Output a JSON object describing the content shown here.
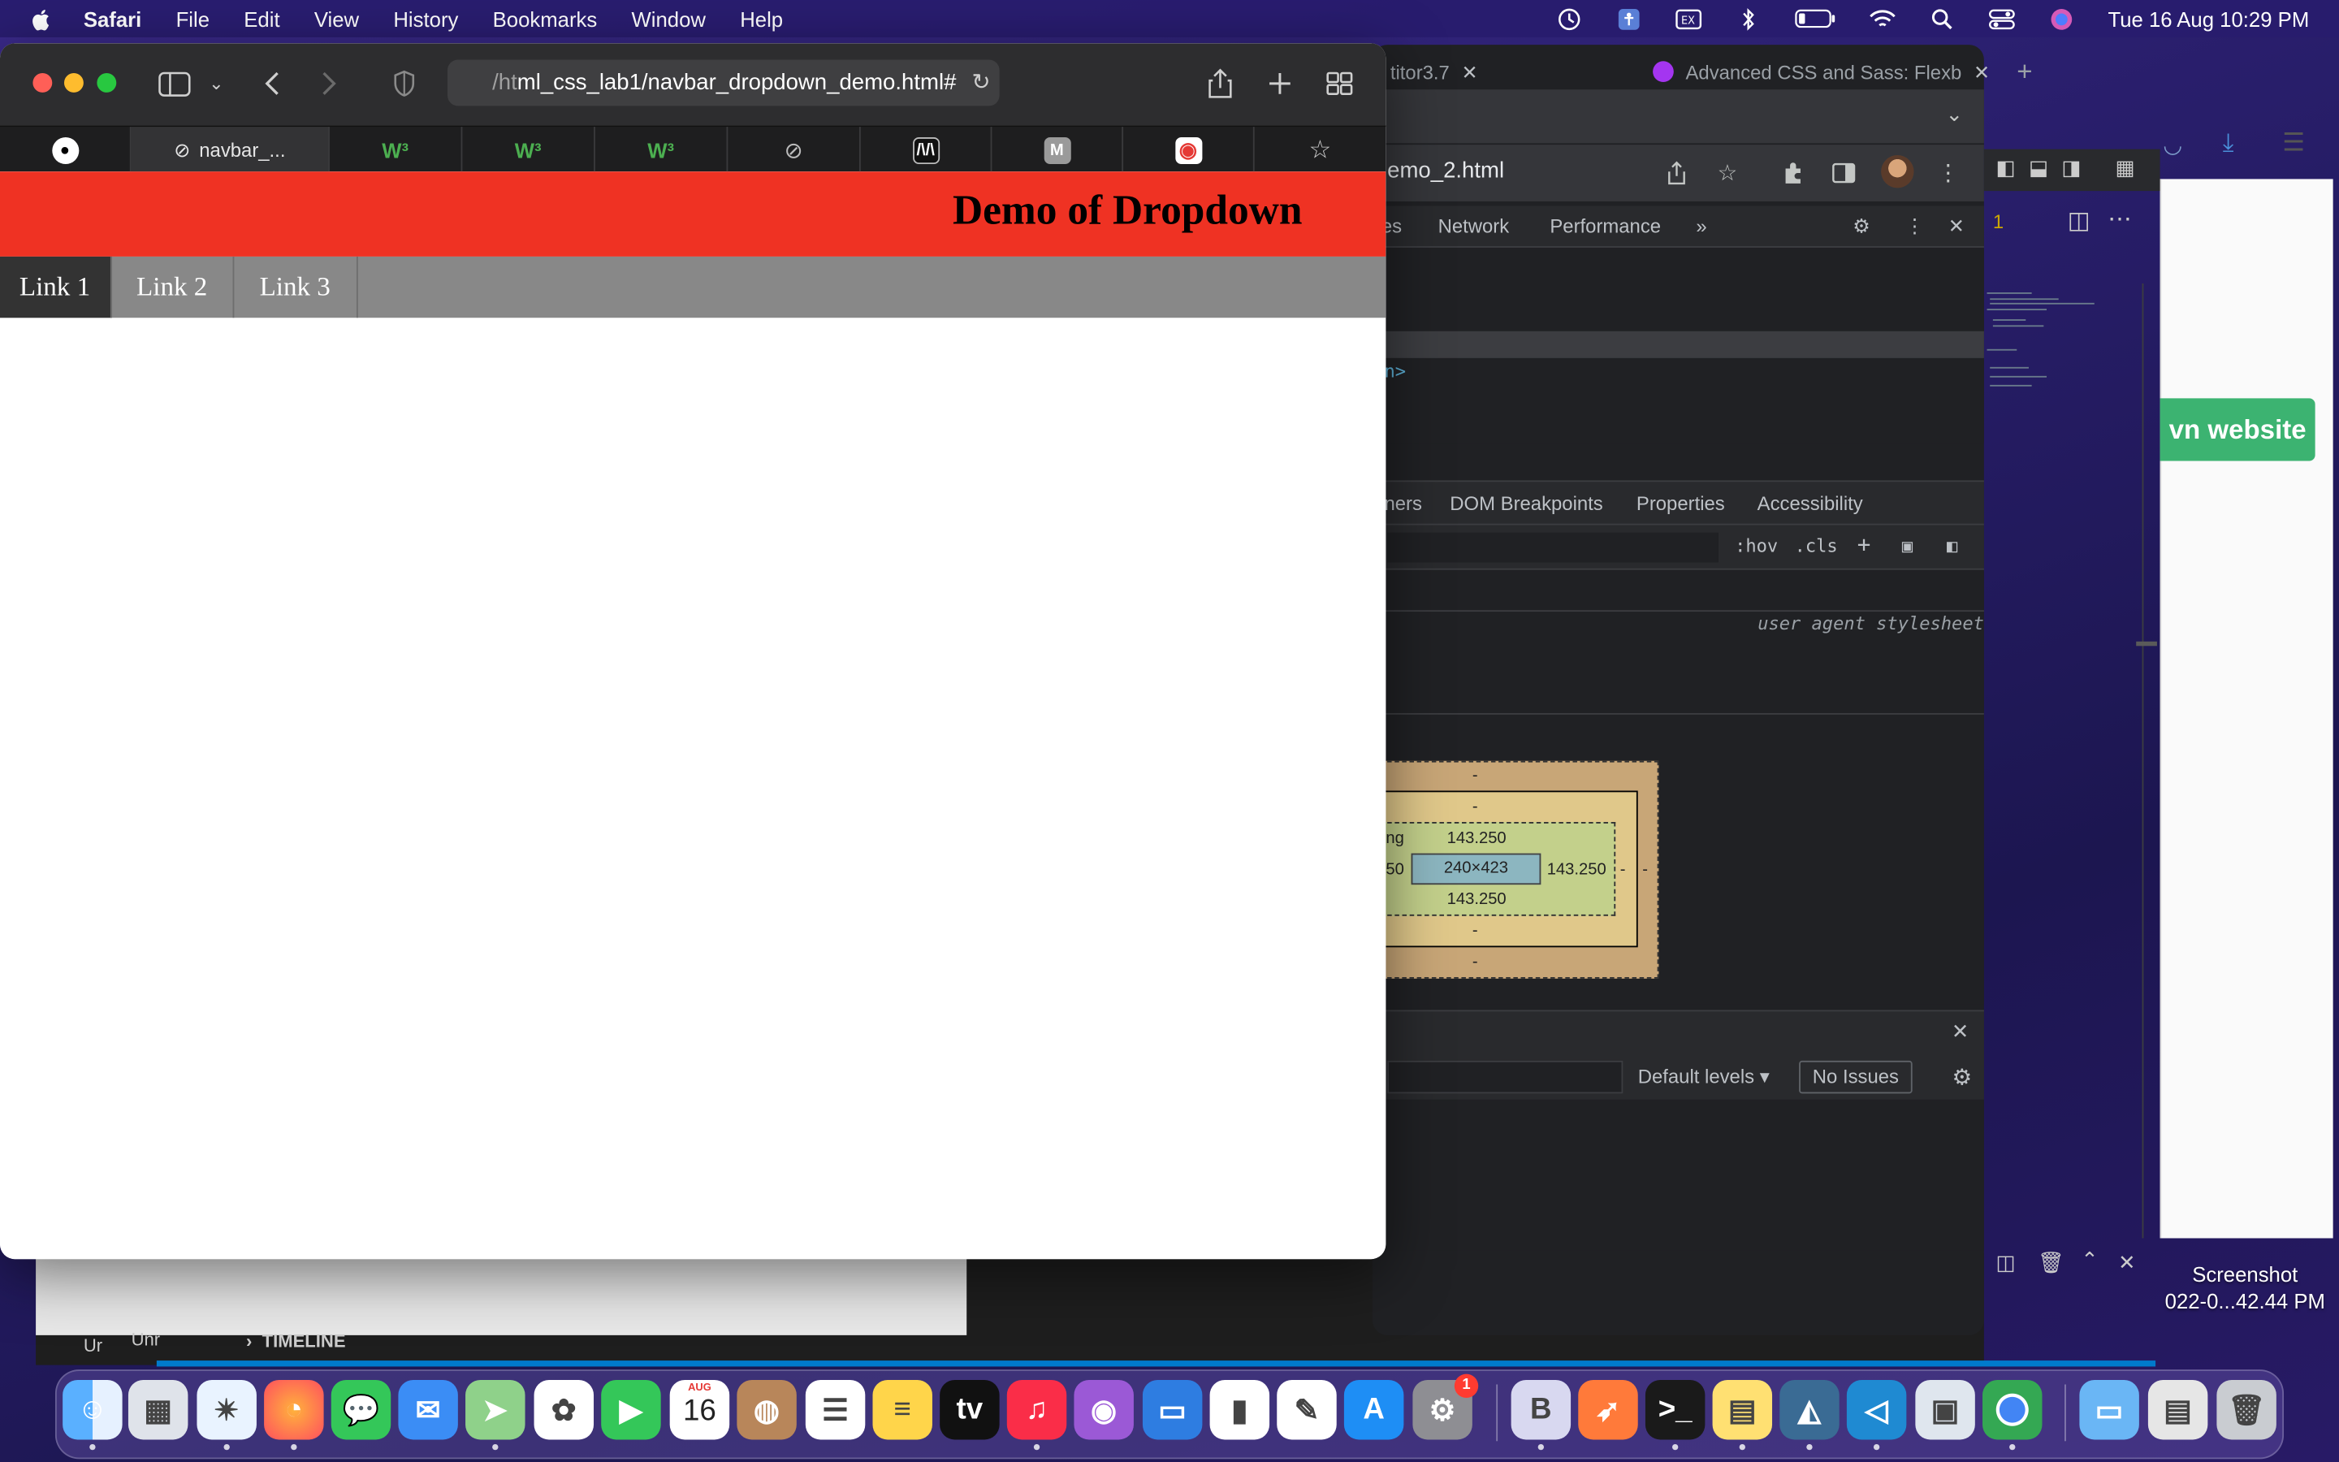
{
  "menubar": {
    "app_name": "Safari",
    "menus": [
      "File",
      "Edit",
      "View",
      "History",
      "Bookmarks",
      "Window",
      "Help"
    ],
    "clock": "Tue 16 Aug  10:29 PM",
    "status_icons": [
      "time-machine-icon",
      "accessibility-icon",
      "input-source-icon",
      "bluetooth-icon",
      "battery-icon",
      "wifi-icon",
      "spotlight-icon",
      "control-center-icon",
      "siri-icon"
    ]
  },
  "safari": {
    "url_prefix": "/ht",
    "url_main": "ml_css_lab1/navbar_dropdown_demo.html#",
    "active_tab_label": "navbar_...",
    "tab_favicons": [
      "github-icon",
      "compass-icon",
      "w3schools-icon",
      "w3schools-icon",
      "w3schools-icon",
      "compass-icon",
      "medium-icon",
      "m-icon",
      "record-icon",
      "star-icon"
    ]
  },
  "page": {
    "title": "Demo of Dropdown",
    "nav_links": [
      "Link 1",
      "Link 2",
      "Link 3"
    ],
    "header_color": "#ef3223",
    "nav_color": "#888888",
    "active_link_color": "#333333"
  },
  "chrome": {
    "tab_partial": "titor3.7",
    "tab2_title": "Advanced CSS and Sass: Flexb",
    "omnibox": "emo_2.html",
    "devtools_tabs": [
      "es",
      "Network",
      "Performance",
      "»"
    ],
    "code_snippet": "n>",
    "subtabs": [
      "ners",
      "DOM Breakpoints",
      "Properties",
      "Accessibility"
    ],
    "filter_buttons": [
      ":hov",
      ".cls",
      "+"
    ],
    "user_agent_stylesheet": "user agent stylesheet",
    "box_model": {
      "margin_top": "-",
      "border_top": "-",
      "padding_label": "ng",
      "padding_top": "143.250",
      "padding_left": "50",
      "content": "240×423",
      "padding_right": "143.250",
      "border_right": "-",
      "margin_right": "-",
      "padding_bottom": "143.250",
      "border_bottom": "-",
      "margin_bottom": "-"
    },
    "console_default_levels": "Default levels",
    "console_issues": "No Issues",
    "warning_count": "1"
  },
  "background": {
    "green_button": "vn website",
    "screenshot_label_line1": "Screenshot",
    "screenshot_label_line2": "022-0...42.44 PM",
    "vscode_timeline": "TIMELINE",
    "vscode_left_labels": [
      "Ur",
      "Unr"
    ]
  },
  "dock": {
    "calendar_month": "AUG",
    "calendar_day": "16",
    "system_prefs_badge": "1",
    "apps": [
      "finder",
      "launchpad",
      "safari",
      "firefox",
      "messages",
      "mail",
      "maps",
      "photos",
      "facetime",
      "calendar",
      "contacts",
      "reminders",
      "notes",
      "tv",
      "music",
      "podcasts",
      "keynote",
      "numbers",
      "pages",
      "app-store",
      "system-preferences",
      "bbedit",
      "swift-playgrounds",
      "terminal",
      "stickies",
      "mysql-workbench",
      "vscode",
      "preview",
      "chrome",
      "downloads-folder",
      "screenshots",
      "trash"
    ]
  }
}
